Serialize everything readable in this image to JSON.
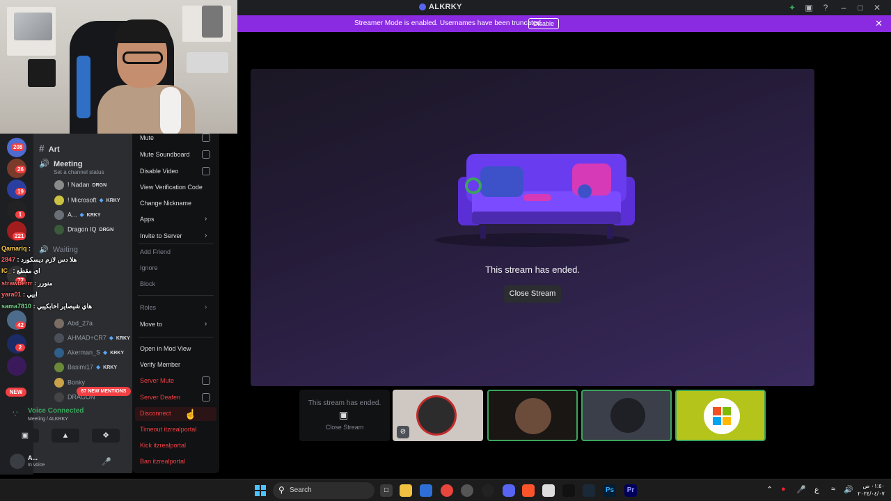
{
  "window": {
    "title": "ALKRKY"
  },
  "banner": {
    "message": "Streamer Mode is enabled. Usernames have been truncated.",
    "disable_label": "Disable"
  },
  "colors": {
    "accent": "#5865f2",
    "banner": "#8a2be2",
    "online": "#3ba55d",
    "danger": "#f23f43"
  },
  "rail": {
    "badges": [
      "208",
      "26",
      "19",
      "1",
      "221",
      "77",
      "42",
      "2"
    ],
    "new_label": "NEW"
  },
  "sidebar": {
    "art_channel": "Art",
    "meeting_channel": "Meeting",
    "meeting_status": "Set a channel status",
    "waiting_channel": "Waiting",
    "members": [
      {
        "name": "! Nadan",
        "tag": "DRGN"
      },
      {
        "name": "! Microsoft",
        "tag": "KRKY"
      },
      {
        "name": "A...",
        "tag": "KRKY"
      },
      {
        "name": "Dragon IQ",
        "tag": "DRGN"
      }
    ],
    "waiting_members": [
      {
        "name": "Abd_27a",
        "tag": ""
      },
      {
        "name": "AHMAD+CR7",
        "tag": "KRKY"
      },
      {
        "name": "Akerman_S",
        "tag": "KRKY"
      },
      {
        "name": "Basimi17",
        "tag": "KRKY"
      },
      {
        "name": "Bonky",
        "tag": ""
      },
      {
        "name": "DRAGON",
        "tag": ""
      }
    ],
    "mentions_label": "67 NEW MENTIONS"
  },
  "chat": [
    {
      "nick": "Qamariq",
      "text": ":"
    },
    {
      "nick": "2847",
      "text": ": هلا دس لازم ديسكورد"
    },
    {
      "nick": "IC_",
      "text": ": اي مقطع"
    },
    {
      "nick": "strawberrr",
      "text": ": منورر"
    },
    {
      "nick": "yara01",
      "text": ": ابيي"
    },
    {
      "nick": "sama7810",
      "text": ": هاي شيصاير اخابكيبي"
    }
  ],
  "voice": {
    "status": "Voice Connected",
    "location": "Meeting / ALKRKY"
  },
  "user": {
    "name": "A...",
    "status": "In voice"
  },
  "context_menu": {
    "items": [
      {
        "label": "Mute",
        "kind": "check"
      },
      {
        "label": "Mute Soundboard",
        "kind": "check"
      },
      {
        "label": "Disable Video",
        "kind": "check"
      },
      {
        "label": "View Verification Code",
        "kind": "plain"
      },
      {
        "label": "Change Nickname",
        "kind": "plain"
      },
      {
        "label": "Apps",
        "kind": "arrow"
      },
      {
        "label": "Invite to Server",
        "kind": "arrow"
      },
      {
        "label": "Add Friend",
        "kind": "disabled"
      },
      {
        "label": "Ignore",
        "kind": "disabled"
      },
      {
        "label": "Block",
        "kind": "disabled-danger"
      },
      {
        "label": "Roles",
        "kind": "arrow-disabled"
      },
      {
        "label": "Move to",
        "kind": "arrow"
      },
      {
        "label": "Open in Mod View",
        "kind": "plain"
      },
      {
        "label": "Verify Member",
        "kind": "plain"
      },
      {
        "label": "Server Mute",
        "kind": "check-danger"
      },
      {
        "label": "Server Deafen",
        "kind": "check-danger"
      },
      {
        "label": "Disconnect",
        "kind": "danger"
      },
      {
        "label": "Timeout itzrealportal",
        "kind": "danger"
      },
      {
        "label": "Kick itzrealportal",
        "kind": "danger"
      },
      {
        "label": "Ban itzrealportal",
        "kind": "danger"
      }
    ]
  },
  "stream": {
    "ended_text": "This stream has ended.",
    "close_label": "Close Stream"
  },
  "thumbs": {
    "ended_text": "This stream has ended.",
    "close_label": "Close Stream"
  },
  "taskbar": {
    "search_placeholder": "Search",
    "time": "٠١:٥٠ ص",
    "date": "٢٠٢٤/٠٤/٠٧"
  }
}
